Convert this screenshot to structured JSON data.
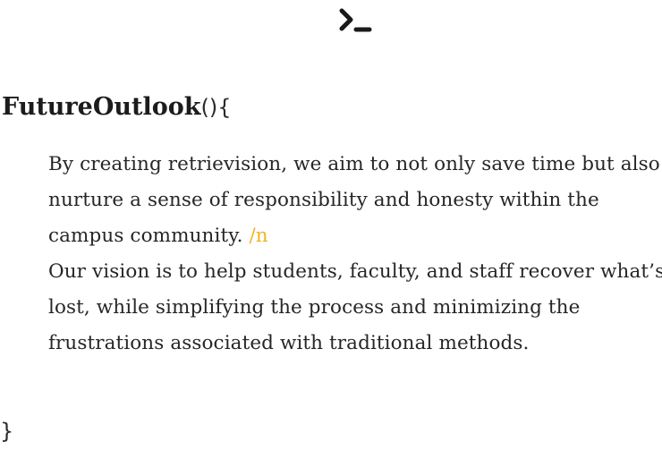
{
  "header": {
    "logo_icon": "terminal-prompt-icon"
  },
  "code": {
    "function_name": "FutureOutlook",
    "open_paren": "(",
    "close_paren": ")",
    "open_brace": "{",
    "close_brace": "}"
  },
  "content": {
    "paragraph1": "By creating retrievision, we aim to not only save time but also nurture a sense of responsibility and honesty within the campus community.",
    "newline_token": "/n",
    "paragraph2": "Our vision is to help students, faculty, and staff recover what’s lost, while simplifying the process and minimizing the frustrations associated with traditional methods."
  },
  "colors": {
    "accent": "#f0b323",
    "text": "#262626",
    "background": "#ffffff"
  }
}
